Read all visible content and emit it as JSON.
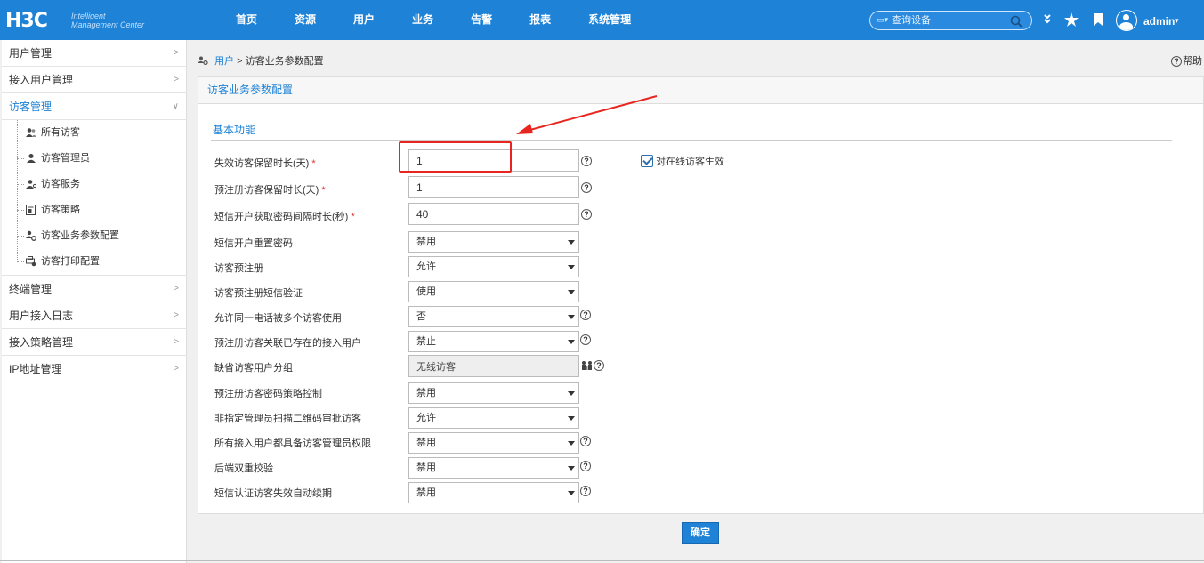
{
  "topbar": {
    "logo_text": "H3C",
    "logo_sub1": "Intelligent",
    "logo_sub2": "Management Center",
    "nav": [
      "首页",
      "资源",
      "用户",
      "业务",
      "告警",
      "报表",
      "系统管理"
    ],
    "search_placeholder": "查询设备",
    "username": "admin"
  },
  "sidebar": {
    "group_user_mgmt": "用户管理",
    "group_access_user": "接入用户管理",
    "group_guest": "访客管理",
    "guest_items": [
      "所有访客",
      "访客管理员",
      "访客服务",
      "访客策略",
      "访客业务参数配置",
      "访客打印配置"
    ],
    "group_terminal": "终端管理",
    "group_access_log": "用户接入日志",
    "group_access_policy": "接入策略管理",
    "group_ip": "IP地址管理"
  },
  "breadcrumb": {
    "link": "用户",
    "separator": ">",
    "current": "访客业务参数配置"
  },
  "help": "帮助",
  "panel": {
    "title": "访客业务参数配置",
    "section": "基本功能",
    "checkbox_label": "对在线访客生效",
    "fields": [
      {
        "label": "失效访客保留时长(天)",
        "value": "1"
      },
      {
        "label": "预注册访客保留时长(天)",
        "value": "1"
      },
      {
        "label": "短信开户获取密码间隔时长(秒)",
        "value": "40"
      },
      {
        "label": "短信开户重置密码",
        "value": "禁用"
      },
      {
        "label": "访客预注册",
        "value": "允许"
      },
      {
        "label": "访客预注册短信验证",
        "value": "使用"
      },
      {
        "label": "允许同一电话被多个访客使用",
        "value": "否"
      },
      {
        "label": "预注册访客关联已存在的接入用户",
        "value": "禁止"
      },
      {
        "label": "缺省访客用户分组",
        "value": "无线访客"
      },
      {
        "label": "预注册访客密码策略控制",
        "value": "禁用"
      },
      {
        "label": "非指定管理员扫描二维码审批访客",
        "value": "允许"
      },
      {
        "label": "所有接入用户都具备访客管理员权限",
        "value": "禁用"
      },
      {
        "label": "后端双重校验",
        "value": "禁用"
      },
      {
        "label": "短信认证访客失效自动续期",
        "value": "禁用"
      }
    ],
    "required_mark": "*"
  },
  "ok_button": "确定",
  "colors": {
    "brand": "#1e82d6",
    "highlight": "#e8251e"
  }
}
